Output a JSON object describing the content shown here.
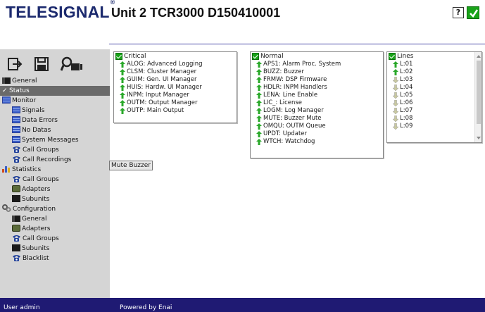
{
  "header": {
    "brand": "TELESIGNAL",
    "brand_mark": "®",
    "unit_title": "Unit 2 TCR3000 D150410001",
    "help_label": "?",
    "status_color": "#19a319"
  },
  "toolbar": {
    "logout_icon": "logout-icon",
    "save_icon": "save-icon",
    "user_search_icon": "user-search-icon"
  },
  "nav": {
    "general": "General",
    "status": "Status",
    "monitor": "Monitor",
    "signals": "Signals",
    "data_errors": "Data Errors",
    "no_datas": "No Datas",
    "system_messages": "System Messages",
    "call_groups": "Call Groups",
    "call_recordings": "Call Recordings",
    "statistics": "Statistics",
    "stat_call_groups": "Call Groups",
    "stat_adapters": "Adapters",
    "stat_subunits": "Subunits",
    "configuration": "Configuration",
    "cfg_general": "General",
    "cfg_adapters": "Adapters",
    "cfg_call_groups": "Call Groups",
    "cfg_subunits": "Subunits",
    "cfg_blacklist": "Blacklist"
  },
  "panels": {
    "critical": {
      "title": "Critical",
      "items": [
        "ALOG: Advanced Logging",
        "CLSM: Cluster Manager",
        "GUIM: Gen. UI Manager",
        "HUIS: Hardw. UI Manager",
        "INPM: Input Manager",
        "OUTM: Output Manager",
        "OUTP: Main Output"
      ]
    },
    "normal": {
      "title": "Normal",
      "items": [
        "APS1: Alarm Proc. System",
        "BUZZ: Buzzer",
        "FRMW: DSP Firmware",
        "HDLR: INPM Handlers",
        "LENA: Line Enable",
        "LIC_: License",
        "LOGM: Log Manager",
        "MUTE: Buzzer Mute",
        "OMQU: OUTM Queue",
        "UPDT: Updater",
        "WTCH: Watchdog"
      ]
    },
    "lines": {
      "title": "Lines",
      "items": [
        {
          "label": "L:01",
          "state": "up"
        },
        {
          "label": "L:02",
          "state": "up"
        },
        {
          "label": "L:03",
          "state": "down"
        },
        {
          "label": "L:04",
          "state": "down"
        },
        {
          "label": "L:05",
          "state": "down"
        },
        {
          "label": "L:06",
          "state": "down"
        },
        {
          "label": "L:07",
          "state": "down"
        },
        {
          "label": "L:08",
          "state": "down"
        },
        {
          "label": "L:09",
          "state": "down"
        }
      ]
    }
  },
  "mute_button": "Mute Buzzer",
  "footer": {
    "user": "User admin",
    "powered": "Powered by Enai"
  },
  "colors": {
    "ok_green": "#19a319",
    "arrow_up": "#2aa82a",
    "arrow_down": "#c9c9a0",
    "footer_bg": "#1f1a73",
    "brand": "#1c2a6e"
  }
}
